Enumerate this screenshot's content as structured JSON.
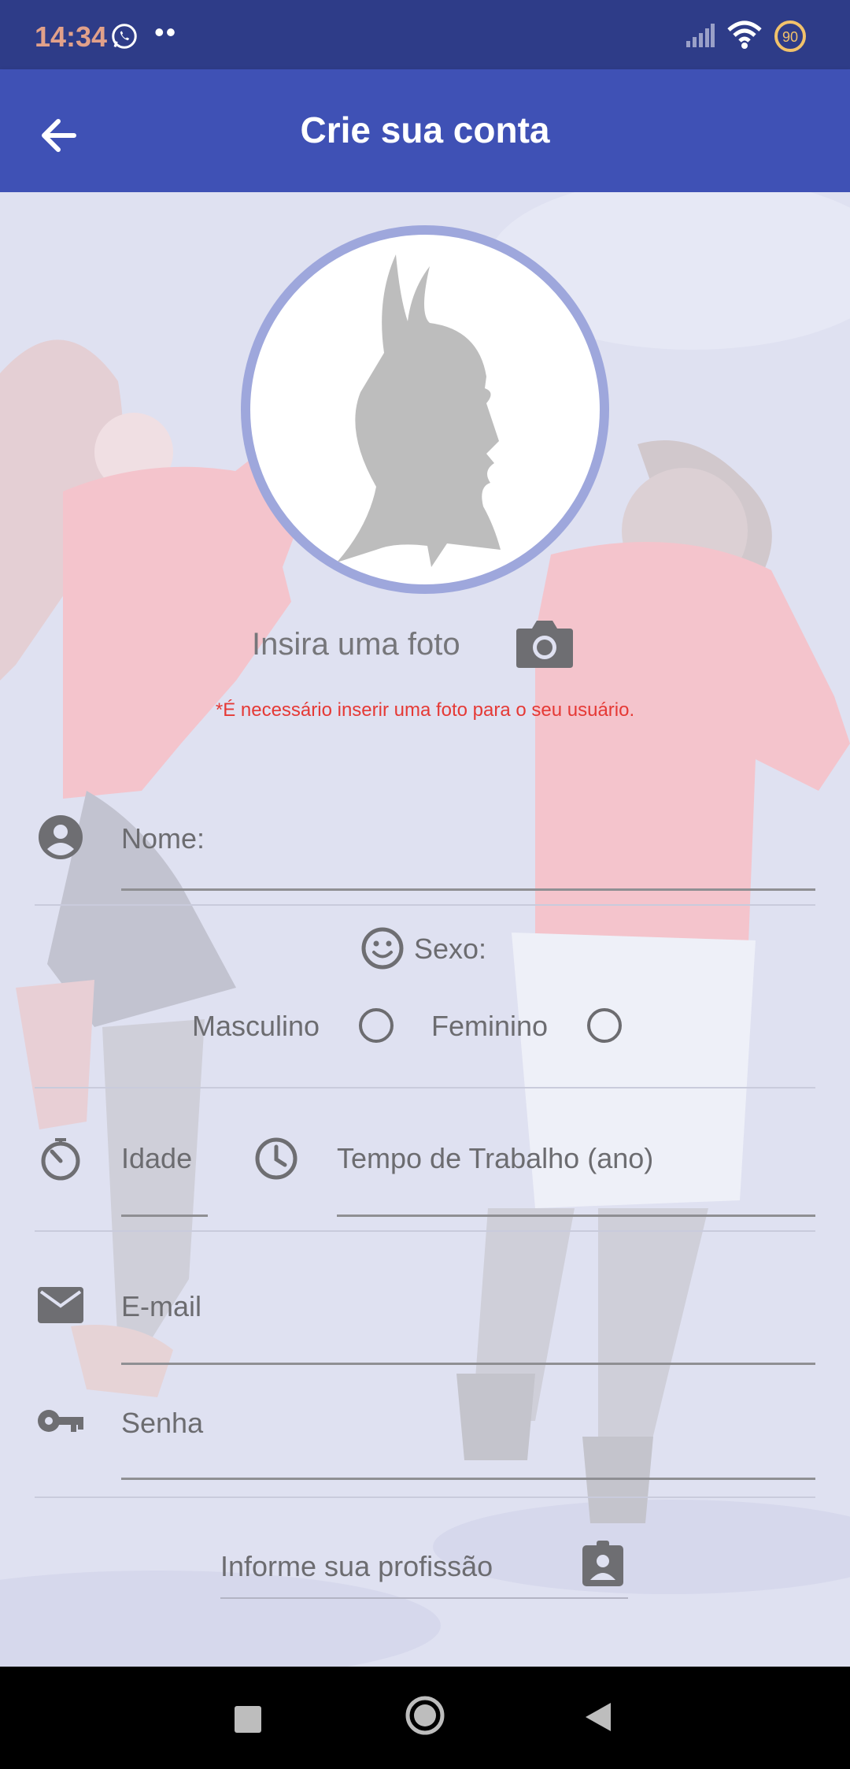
{
  "status_bar": {
    "time": "14:34",
    "dots": "••",
    "battery": "90"
  },
  "app_bar": {
    "title": "Crie sua conta",
    "back_icon": "arrow-left-icon"
  },
  "photo": {
    "label": "Insira uma foto",
    "warning": "*É necessário inserir uma foto para o seu usuário.",
    "camera_icon": "camera-icon"
  },
  "form": {
    "name": {
      "placeholder": "Nome:",
      "icon": "account-circle-icon"
    },
    "sex": {
      "label": "Sexo:",
      "icon": "smiley-icon",
      "options": [
        {
          "label": "Masculino",
          "selected": false
        },
        {
          "label": "Feminino",
          "selected": false
        }
      ]
    },
    "age": {
      "placeholder": "Idade",
      "icon": "timer-icon"
    },
    "work_time": {
      "placeholder": "Tempo de Trabalho (ano)",
      "icon": "clock-icon"
    },
    "email": {
      "placeholder": "E-mail",
      "icon": "mail-icon"
    },
    "password": {
      "placeholder": "Senha",
      "icon": "key-icon"
    },
    "profession": {
      "placeholder": "Informe sua profissão",
      "icon": "badge-icon"
    }
  },
  "colors": {
    "status_bar": "#2e3c88",
    "app_bar": "#3f51b5",
    "avatar_border": "#9ea7dc",
    "warning": "#e53935",
    "background": "#dfe1f1"
  }
}
